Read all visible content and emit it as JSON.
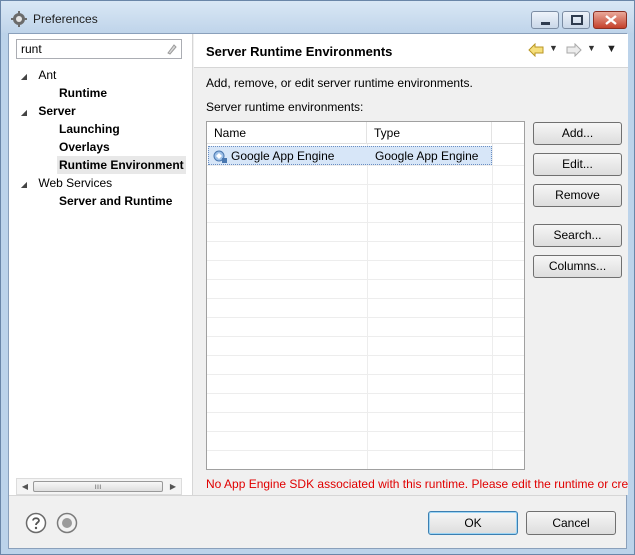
{
  "window": {
    "title": "Preferences"
  },
  "filter": {
    "value": "runt"
  },
  "tree": {
    "items": [
      {
        "label": "Ant",
        "level": 0,
        "expanded": true
      },
      {
        "label": "Runtime",
        "level": 1
      },
      {
        "label": "Server",
        "level": 0,
        "expanded": true
      },
      {
        "label": "Launching",
        "level": 1
      },
      {
        "label": "Overlays",
        "level": 1
      },
      {
        "label": "Runtime Environment",
        "level": 1,
        "selected": true
      },
      {
        "label": "Web Services",
        "level": 0,
        "expanded": true
      },
      {
        "label": "Server and Runtime",
        "level": 1
      }
    ]
  },
  "page": {
    "title": "Server Runtime Environments",
    "description": "Add, remove, or edit server runtime environments.",
    "table_label": "Server runtime environments:",
    "columns": [
      "Name",
      "Type"
    ],
    "rows": [
      {
        "name": "Google App Engine",
        "type": "Google App Engine",
        "selected": true
      }
    ],
    "buttons": {
      "add": "Add...",
      "edit": "Edit...",
      "remove": "Remove",
      "search": "Search...",
      "columns": "Columns..."
    },
    "error": "No App Engine SDK associated with this runtime. Please edit the runtime or create a new one."
  },
  "footer": {
    "ok": "OK",
    "cancel": "Cancel"
  },
  "colors": {
    "error": "#e00000",
    "selection": "#d7e6f8"
  }
}
